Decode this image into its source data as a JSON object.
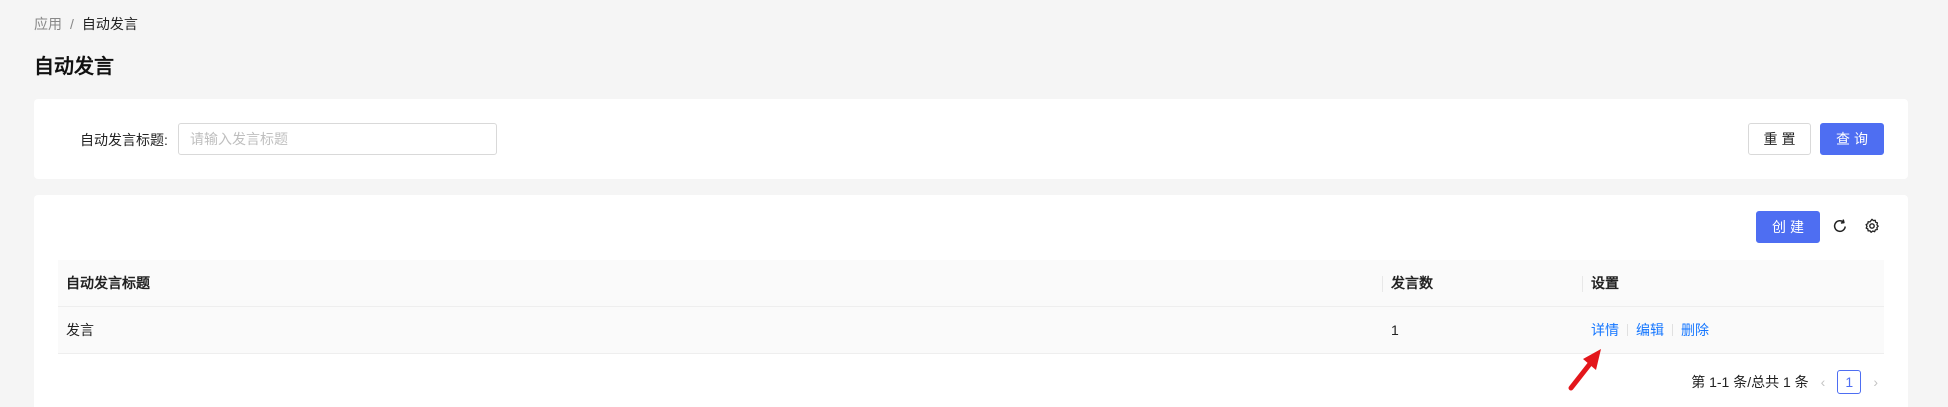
{
  "breadcrumb": {
    "root": "应用",
    "separator": "/",
    "current": "自动发言"
  },
  "page_title": "自动发言",
  "search": {
    "label": "自动发言标题:",
    "placeholder": "请输入发言标题",
    "value": "",
    "reset_label": "重置",
    "query_label": "查询"
  },
  "toolbar": {
    "create_label": "创建",
    "refresh_icon": "refresh-icon",
    "settings_icon": "gear-icon"
  },
  "table": {
    "columns": [
      "自动发言标题",
      "发言数",
      "设置"
    ],
    "rows": [
      {
        "title": "发言",
        "count": "1",
        "actions": [
          "详情",
          "编辑",
          "删除"
        ]
      }
    ]
  },
  "pagination": {
    "summary": "第 1-1 条/总共 1 条",
    "current_page": "1"
  },
  "colors": {
    "primary": "#4e6ef2",
    "link": "#1677ff",
    "annotation_arrow": "#e3161b"
  }
}
